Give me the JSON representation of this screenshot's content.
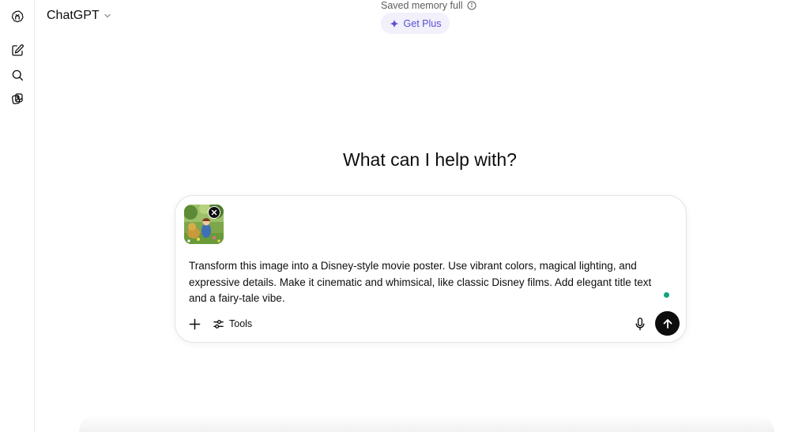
{
  "app": {
    "model_name": "ChatGPT"
  },
  "sidebar": {
    "items": [
      {
        "icon": "openai-logo-icon"
      },
      {
        "icon": "new-chat-icon"
      },
      {
        "icon": "search-icon"
      },
      {
        "icon": "library-icon"
      }
    ]
  },
  "banner": {
    "memory_text": "Saved memory full",
    "upgrade_label": "Get Plus"
  },
  "main": {
    "headline": "What can I help with?"
  },
  "composer": {
    "prompt_text": "Transform this image into a Disney-style movie poster. Use vibrant colors, magical lighting, and expressive details. Make it cinematic and whimsical, like classic Disney films. Add elegant title text and a fairy-tale vibe.",
    "tools_label": "Tools",
    "attachment": "image-thumbnail"
  },
  "colors": {
    "accent": "#5a4fcf",
    "accent_bg": "#f1f0fb",
    "status_dot": "#10a37f",
    "send_button": "#0d0d0d"
  }
}
